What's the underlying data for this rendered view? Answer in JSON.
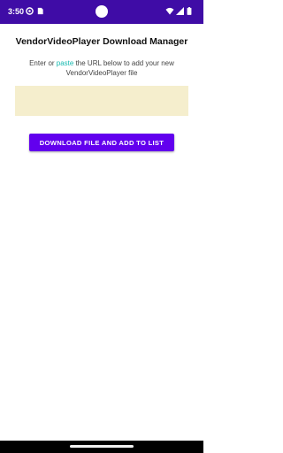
{
  "status_bar": {
    "time": "3:50",
    "left_icons": [
      "settings-icon",
      "sim-card-icon"
    ],
    "right_icons": [
      "wifi-icon",
      "cellular-signal-icon",
      "battery-icon"
    ],
    "color": "#3f0ca6"
  },
  "page": {
    "title": "VendorVideoPlayer Download Manager",
    "instruction_prefix": "Enter or ",
    "instruction_link": "paste",
    "instruction_suffix": " the URL below to add your new VendorVideoPlayer file"
  },
  "url_input": {
    "value": "",
    "placeholder": ""
  },
  "download_button": {
    "label": "DOWNLOAD FILE AND ADD TO LIST"
  },
  "colors": {
    "accent": "#6200ee",
    "input_background": "#f5eecd",
    "link": "#16b9b0"
  }
}
